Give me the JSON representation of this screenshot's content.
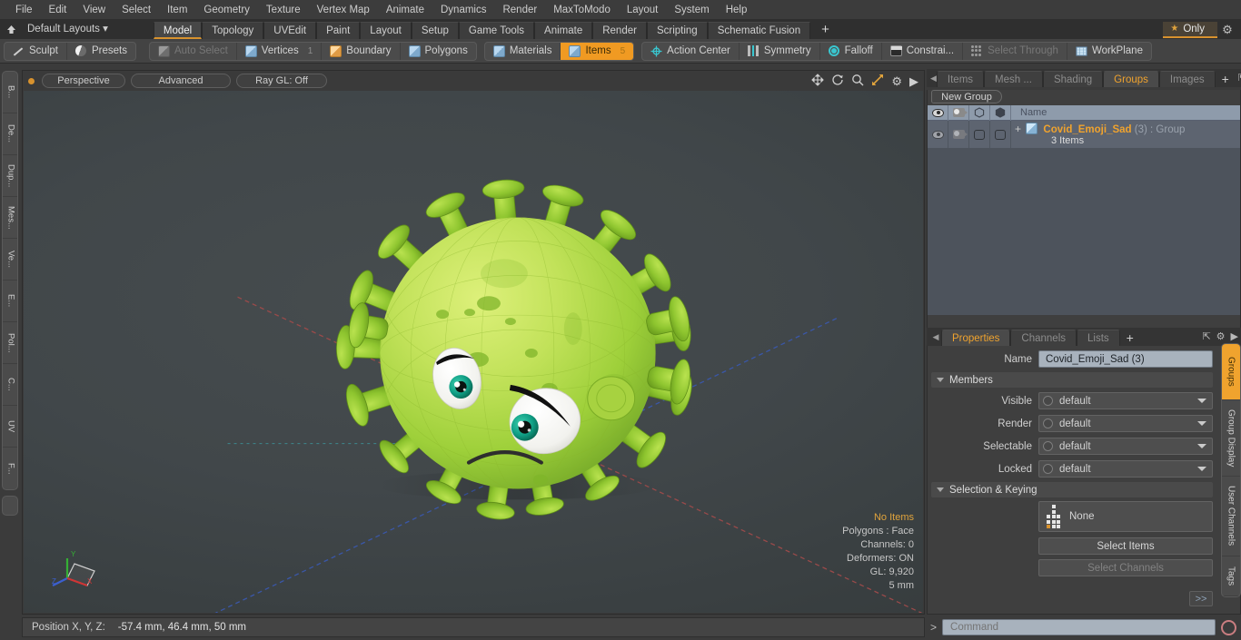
{
  "app": {
    "menu": [
      "File",
      "Edit",
      "View",
      "Select",
      "Item",
      "Geometry",
      "Texture",
      "Vertex Map",
      "Animate",
      "Dynamics",
      "Render",
      "MaxToModo",
      "Layout",
      "System",
      "Help"
    ],
    "layout_label": "Default Layouts",
    "layout_tabs": [
      {
        "label": "Model",
        "selected": true
      },
      {
        "label": "Topology",
        "selected": false
      },
      {
        "label": "UVEdit",
        "selected": false
      },
      {
        "label": "Paint",
        "selected": false
      },
      {
        "label": "Layout",
        "selected": false
      },
      {
        "label": "Setup",
        "selected": false
      },
      {
        "label": "Game Tools",
        "selected": false
      },
      {
        "label": "Animate",
        "selected": false
      },
      {
        "label": "Render",
        "selected": false
      },
      {
        "label": "Scripting",
        "selected": false
      },
      {
        "label": "Schematic Fusion",
        "selected": false
      }
    ],
    "add_tab": "+",
    "only_label": "Only",
    "accent": "#f0a32e"
  },
  "toolbar": {
    "left_group": [
      {
        "label": "Sculpt",
        "icon": "brush-icon"
      },
      {
        "label": "Presets",
        "icon": "sphere-icon"
      }
    ],
    "select_group": [
      {
        "label": "Auto Select",
        "num": "",
        "state": "disabled",
        "icon": "cube-grey-icon"
      },
      {
        "label": "Vertices",
        "num": "1",
        "state": "normal",
        "icon": "cube-blue-icon"
      },
      {
        "label": "Boundary",
        "num": "",
        "state": "normal",
        "icon": "cube-orange-icon"
      },
      {
        "label": "Polygons",
        "num": "",
        "state": "normal",
        "icon": "cube-blue-icon"
      }
    ],
    "mode_group": [
      {
        "label": "Materials",
        "num": "",
        "state": "normal",
        "icon": "cube-blue-icon"
      },
      {
        "label": "Items",
        "num": "5",
        "state": "active",
        "icon": "cube-orange-icon"
      }
    ],
    "opts_group": [
      {
        "label": "Action Center",
        "state": "normal",
        "icon": "action-center-icon"
      },
      {
        "label": "Symmetry",
        "state": "normal",
        "icon": "symmetry-icon"
      },
      {
        "label": "Falloff",
        "state": "normal",
        "icon": "falloff-icon"
      },
      {
        "label": "Constrai...",
        "state": "normal",
        "icon": "constraint-icon"
      },
      {
        "label": "Select Through",
        "state": "disabled",
        "icon": "select-through-icon"
      },
      {
        "label": "WorkPlane",
        "state": "normal",
        "icon": "workplane-icon"
      }
    ]
  },
  "left_tabs": [
    "B...",
    "De...",
    "Dup...",
    "Mes...",
    "Ve...",
    "E...",
    "Pol...",
    "C...",
    "UV",
    "F..."
  ],
  "viewport": {
    "view_mode": "Perspective",
    "shading": "Advanced",
    "raygl": "Ray GL: Off",
    "icons": [
      "move-icon",
      "rotate-icon",
      "zoom-icon",
      "fit-icon",
      "gear-icon",
      "play-icon"
    ],
    "stats": {
      "items": "No Items",
      "polygons": "Polygons : Face",
      "channels": "Channels: 0",
      "deformers": "Deformers: ON",
      "gl": "GL: 9,920",
      "scale": "5 mm"
    },
    "gizmo_axes": [
      "X",
      "Y",
      "Z"
    ]
  },
  "right_panel": {
    "tabs": [
      {
        "label": "Items",
        "selected": false
      },
      {
        "label": "Mesh ...",
        "selected": false
      },
      {
        "label": "Shading",
        "selected": false
      },
      {
        "label": "Groups",
        "selected": true
      },
      {
        "label": "Images",
        "selected": false
      }
    ],
    "add_tab": "+",
    "new_group_button": "New Group",
    "list_header": {
      "name": "Name",
      "cols": [
        "visible-eye-icon",
        "render-camera-icon",
        "selectable-cube-icon",
        "locked-cube-icon"
      ]
    },
    "rows": [
      {
        "name": "Covid_Emoji_Sad",
        "count": "(3)",
        "type": ": Group",
        "sub": "3 Items"
      }
    ]
  },
  "properties": {
    "tabs": [
      {
        "label": "Properties",
        "selected": true
      },
      {
        "label": "Channels",
        "selected": false
      },
      {
        "label": "Lists",
        "selected": false
      }
    ],
    "add_tab": "+",
    "name_label": "Name",
    "name_value": "Covid_Emoji_Sad (3)",
    "members_section": "Members",
    "fields": [
      {
        "label": "Visible",
        "value": "default"
      },
      {
        "label": "Render",
        "value": "default"
      },
      {
        "label": "Selectable",
        "value": "default"
      },
      {
        "label": "Locked",
        "value": "default"
      }
    ],
    "keying_section": "Selection & Keying",
    "keying_value": "None",
    "buttons": [
      {
        "label": "Select Items",
        "disabled": false
      },
      {
        "label": "Select Channels",
        "disabled": true
      }
    ],
    "push_label": ">>"
  },
  "right_tabs": [
    {
      "label": "Groups",
      "selected": true
    },
    {
      "label": "Group Display",
      "selected": false
    },
    {
      "label": "User Channels",
      "selected": false
    },
    {
      "label": "Tags",
      "selected": false
    }
  ],
  "status": {
    "position_label": "Position X, Y, Z:",
    "position_value": "-57.4 mm, 46.4 mm, 50 mm",
    "command_prompt": ">",
    "command_placeholder": "Command"
  }
}
